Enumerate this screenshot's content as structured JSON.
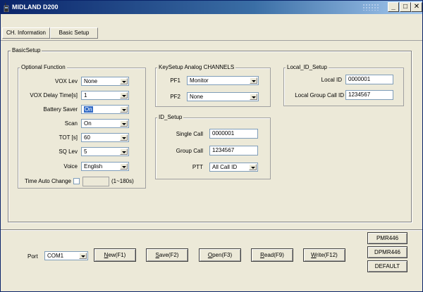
{
  "window": {
    "title": "MIDLAND D200",
    "controls": {
      "minimize": "_",
      "maximize": "□",
      "close": "✕"
    }
  },
  "tabs": [
    {
      "label": "CH. Information"
    },
    {
      "label": "Basic Setup"
    }
  ],
  "basic_setup": {
    "legend": "BasicSetup",
    "optional_function": {
      "legend": "Optional Function",
      "vox_lev": {
        "label": "VOX Lev",
        "value": "None"
      },
      "vox_delay": {
        "label": "VOX Delay Time[s]",
        "value": "1"
      },
      "battery_saver": {
        "label": "Battery Saver",
        "value": "On"
      },
      "scan": {
        "label": "Scan",
        "value": "On"
      },
      "tot": {
        "label": "TOT [s]",
        "value": "60"
      },
      "sq_lev": {
        "label": "SQ Lev",
        "value": "5"
      },
      "voice": {
        "label": "Voice",
        "value": "English"
      },
      "time_auto_change": {
        "label": "Time Auto Change",
        "value": "",
        "range": "(1~180s)",
        "checked": false
      }
    },
    "key_setup": {
      "legend": "KeySetup Analog CHANNELS",
      "pf1": {
        "label": "PF1",
        "value": "Monitor"
      },
      "pf2": {
        "label": "PF2",
        "value": "None"
      }
    },
    "id_setup": {
      "legend": "ID_Setup",
      "single_call": {
        "label": "Single Call",
        "value": "0000001"
      },
      "group_call": {
        "label": "Group Call",
        "value": "1234567"
      },
      "ptt": {
        "label": "PTT",
        "value": "All Call ID"
      }
    },
    "local_id_setup": {
      "legend": "Local_ID_Setup",
      "local_id": {
        "label": "Local ID",
        "value": "0000001"
      },
      "local_group_call_id": {
        "label": "Local Group Call ID",
        "value": "1234567"
      }
    }
  },
  "bottom": {
    "port_label": "Port",
    "port_value": "COM1",
    "buttons": {
      "new": {
        "key": "N",
        "rest": "ew(F1)"
      },
      "save": {
        "key": "S",
        "rest": "ave(F2)"
      },
      "open": {
        "key": "O",
        "rest": "pen(F3)"
      },
      "read": {
        "key": "R",
        "rest": "ead(F9)"
      },
      "write": {
        "key": "W",
        "rest": "rite(F12)"
      }
    },
    "side_buttons": {
      "pmr446": "PMR446",
      "dpmr446": "DPMR446",
      "default": "DEFAULT"
    }
  },
  "colors": {
    "titlebar_start": "#0a246a",
    "titlebar_end": "#a6caf0",
    "window_bg": "#ece9d8",
    "selection": "#316ac5"
  }
}
